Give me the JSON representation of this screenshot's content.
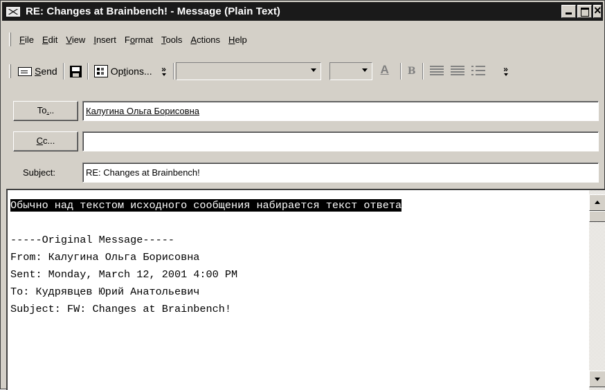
{
  "window": {
    "title": "RE: Changes at Brainbench! - Message (Plain Text)",
    "title_bar_color": "#1a1a1a"
  },
  "menu": {
    "items": [
      {
        "pre": "",
        "key": "F",
        "post": "ile"
      },
      {
        "pre": "",
        "key": "E",
        "post": "dit"
      },
      {
        "pre": "",
        "key": "V",
        "post": "iew"
      },
      {
        "pre": "",
        "key": "I",
        "post": "nsert"
      },
      {
        "pre": "F",
        "key": "o",
        "post": "rmat"
      },
      {
        "pre": "",
        "key": "T",
        "post": "ools"
      },
      {
        "pre": "",
        "key": "A",
        "post": "ctions"
      },
      {
        "pre": "",
        "key": "H",
        "post": "elp"
      }
    ]
  },
  "toolbar": {
    "send_pre": "",
    "send_key": "S",
    "send_post": "end",
    "options_pre": "Op",
    "options_key": "t",
    "options_post": "ions...",
    "more_glyph": "»",
    "font_color_glyph": "A",
    "bold_glyph": "B"
  },
  "header": {
    "to_button": {
      "pre": "To",
      "key": ".",
      "post": ".."
    },
    "cc_button": {
      "pre": "",
      "key": "C",
      "post": "c..."
    },
    "subject_label": "Subject:",
    "to_value": "Калугина Ольга Борисовна",
    "cc_value": "",
    "subject_value": "RE: Changes at Brainbench!"
  },
  "body": {
    "selected_line": "Обычно над текстом исходного сообщения набирается текст ответа",
    "lines": [
      "",
      "-----Original Message-----",
      "From: Калугина Ольга Борисовна",
      "Sent: Monday, March 12, 2001 4:00 PM",
      "To: Кудрявцев Юрий Анатольевич",
      "Subject: FW: Changes at Brainbench!"
    ]
  }
}
